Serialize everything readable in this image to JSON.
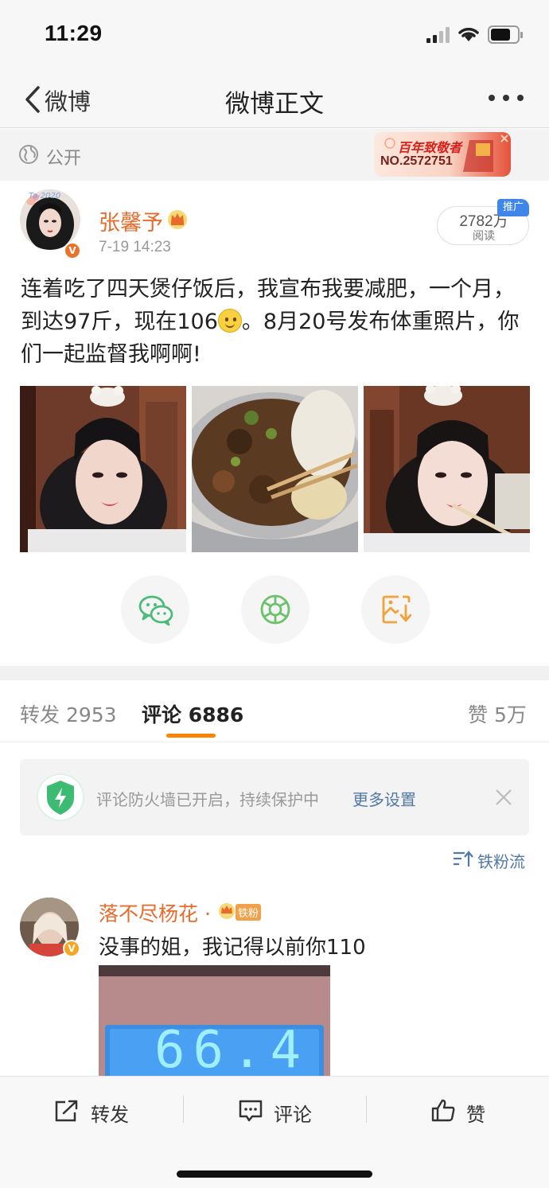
{
  "status_bar": {
    "time": "11:29"
  },
  "nav": {
    "back_label": "微博",
    "title": "微博正文",
    "more_icon": "more-dots-icon"
  },
  "visibility": {
    "label": "公开",
    "badge_title": "百年致敬者",
    "badge_number": "NO.2572751"
  },
  "author": {
    "name": "张馨予",
    "time": "7-19 14:23",
    "avatar_tag": "Ta-2020",
    "verified_mark": "V"
  },
  "reads": {
    "count": "2782万",
    "label": "阅读",
    "promo_tag": "推广"
  },
  "post": {
    "text_before": "连着吃了四天煲仔饭后，我宣布我要减肥，一个月，到达97斤，现在106",
    "text_after": "。8月20号发布体重照片，你们一起监督我啊啊!"
  },
  "share": [
    "wechat-icon",
    "moments-icon",
    "save-image-icon"
  ],
  "tabs": {
    "repost": "转发 2953",
    "comments_label": "评论",
    "comments_count": "6886",
    "likes": "赞 5万"
  },
  "firewall": {
    "text": "评论防火墙已开启，持续保护中",
    "link": "更多设置"
  },
  "sort": {
    "label": "铁粉流"
  },
  "comment": {
    "name": "落不尽杨花 · ",
    "badge": "铁粉",
    "text": "没事的姐，我记得以前你110",
    "scale_reading": "66.4"
  },
  "bottom": {
    "repost": "转发",
    "comment": "评论",
    "like": "赞"
  },
  "colors": {
    "accent_orange": "#ff8200",
    "name_orange": "#e86b2a",
    "link_blue": "#5278a8"
  }
}
